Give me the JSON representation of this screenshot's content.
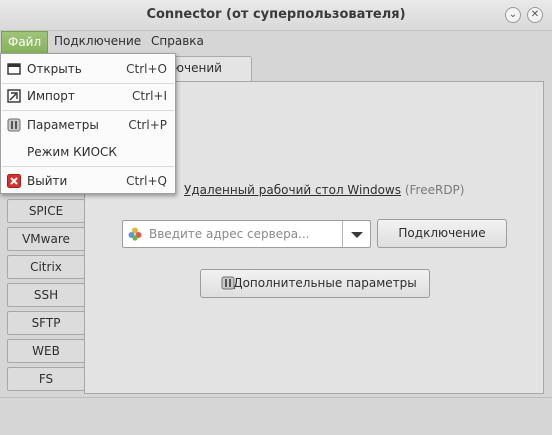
{
  "window": {
    "title": "Connector (от суперпользователя)"
  },
  "menubar": {
    "file": "Файл",
    "connection": "Подключение",
    "help": "Справка"
  },
  "file_menu": {
    "open": {
      "label": "Открыть",
      "accel": "Ctrl+O"
    },
    "import": {
      "label": "Импорт",
      "accel": "Ctrl+I"
    },
    "settings": {
      "label": "Параметры",
      "accel": "Ctrl+P"
    },
    "kiosk": {
      "label": "Режим КИОСК"
    },
    "quit": {
      "label": "Выйти",
      "accel": "Ctrl+Q"
    }
  },
  "tabs": {
    "visible_fragment": "ключений"
  },
  "protocols": [
    "SPICE",
    "VMware",
    "Citrix",
    "SSH",
    "SFTP",
    "WEB",
    "FS"
  ],
  "main": {
    "protocol_name": "Удаленный рабочий стол Windows",
    "protocol_sub": "(FreeRDP)",
    "address_placeholder": "Введите адрес сервера...",
    "connect_label": "Подключение",
    "advanced_label": "Дополнительные параметры"
  },
  "colors": {
    "accent": "#86b25c",
    "quit_icon": "#d9302c"
  }
}
